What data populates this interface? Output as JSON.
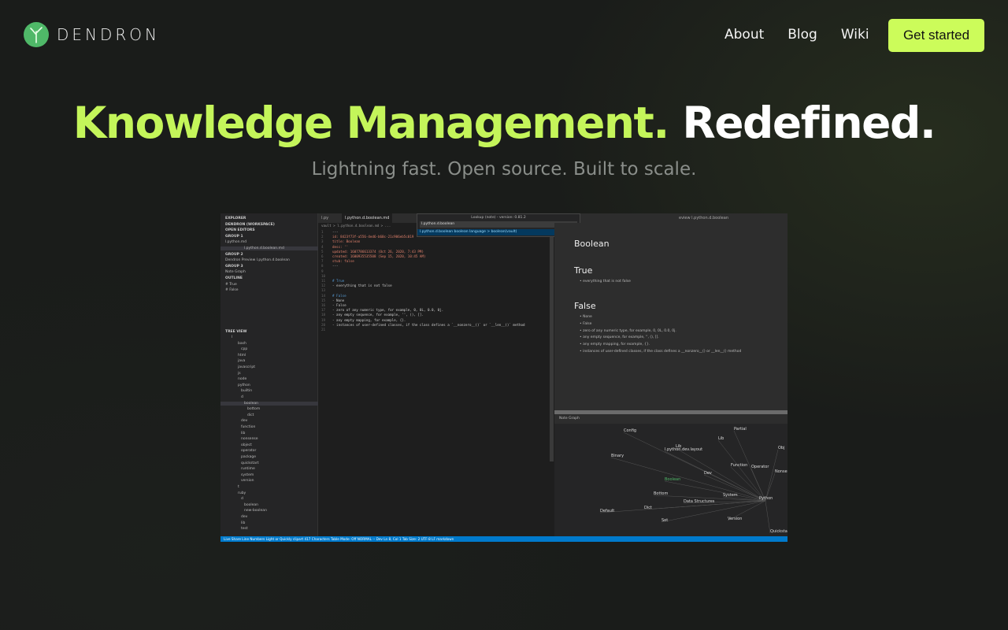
{
  "nav": {
    "logo_text": "DENDRON",
    "links": [
      "About",
      "Blog",
      "Wiki"
    ],
    "cta_label": "Get started"
  },
  "hero": {
    "title_green": "Knowledge Management.",
    "title_white": "Redefined.",
    "subtitle": "Lightning fast. Open source. Built to scale."
  },
  "colors": {
    "accent": "#c4f55a",
    "cta_bg": "#ccfc5a",
    "background": "#1a1c1a",
    "logo": "#4fb868"
  },
  "screenshot": {
    "sidebar": [
      {
        "text": "EXPLORER",
        "cls": "head"
      },
      {
        "text": "DENDRON (WORKSPACE)",
        "cls": "head"
      },
      {
        "text": "OPEN EDITORS",
        "cls": "head"
      },
      {
        "text": "GROUP 1",
        "cls": "head"
      },
      {
        "text": "l.python.md",
        "cls": ""
      },
      {
        "text": "l.python.d.boolean.md",
        "cls": "sel"
      },
      {
        "text": "GROUP 2",
        "cls": "head"
      },
      {
        "text": "Dendron Preview l.python.d.boolean",
        "cls": ""
      },
      {
        "text": "GROUP 3",
        "cls": "head"
      },
      {
        "text": "Note Graph",
        "cls": ""
      },
      {
        "text": "OUTLINE",
        "cls": "head"
      },
      {
        "text": "# True",
        "cls": ""
      },
      {
        "text": "# False",
        "cls": ""
      }
    ],
    "tree_head": "TREE VIEW",
    "tree": [
      "l",
      "bash",
      "cpp",
      "html",
      "java",
      "javascript",
      "js",
      "node",
      "python",
      "builtin",
      "d",
      "boolean",
      "bottom",
      "dict",
      "dev",
      "function",
      "lib",
      "nonsense",
      "object",
      "operator",
      "package",
      "quickstart",
      "runtime",
      "system",
      "version",
      "t",
      "ruby",
      "d",
      "boolean",
      "new-boolean",
      "dev",
      "lib",
      "test"
    ],
    "tabs": [
      "l.py",
      "l.python.d.boolean.md",
      "eview l.python.d.boolean"
    ],
    "breadcrumb": "vault > l.python.d.boolean.md > ...",
    "code": [
      "---",
      "id: 8423f73f-a556-4ed6-b60c-21c906eb5c019",
      "title: Boolean",
      "desc: ''",
      "updated: 1607786613374 (Oct 26, 2020, 7:43 PM)",
      "created: 1600935535508 (Sep 15, 2020, 10:45 AM)",
      "stub: false",
      "---",
      "",
      "",
      "# True",
      "- everything that is not false",
      "",
      "# False",
      "- None",
      "- False",
      "- zero of any numeric type, for example, 0, 0L, 0.0, 0j.",
      "- any empty sequence, for example, '', (), [].",
      "- any empty mapping, for example, {}.",
      "- instances of user-defined classes, if the class defines a `__nonzero__()` or `__len__()` method",
      ""
    ],
    "lookup": {
      "title": "Lookup (note) - version: 0.81.2",
      "input": "l.python.d.boolean",
      "result": "l.python.d.boolean  boolean  language > boolean(vault)"
    },
    "preview": {
      "h_boolean": "Boolean",
      "h_true": "True",
      "true_items": [
        "everything that is not false"
      ],
      "h_false": "False",
      "false_items": [
        "None",
        "False",
        "zero of any numeric type, for example, 0, 0L, 0.0, 0j.",
        "any empty sequence, for example, '', (), [].",
        "any empty mapping, for example, {}.",
        "instances of user-defined classes, if the class defines a __nonzero__() or __len__() method"
      ]
    },
    "graph_tab": "Note Graph",
    "graph_nodes": [
      "Config",
      "Lib",
      "Partial",
      "Binary",
      "l.python.dev.layout",
      "Lib",
      "Obj",
      "Function",
      "Operator",
      "Nonse",
      "Boolean",
      "Dev",
      "Bottom",
      "System",
      "Python",
      "Data Structures",
      "Default",
      "Dict",
      "Version",
      "Set",
      "Quickstart"
    ],
    "status": "Live Share   Line Numbers   Light or Quickly   clipart   417 Characters   Table Mode: Off   NORMAL --                                                          Dev   Ln 8, Col 1   Tab Size: 2   UTF-8   LF   markdown"
  }
}
